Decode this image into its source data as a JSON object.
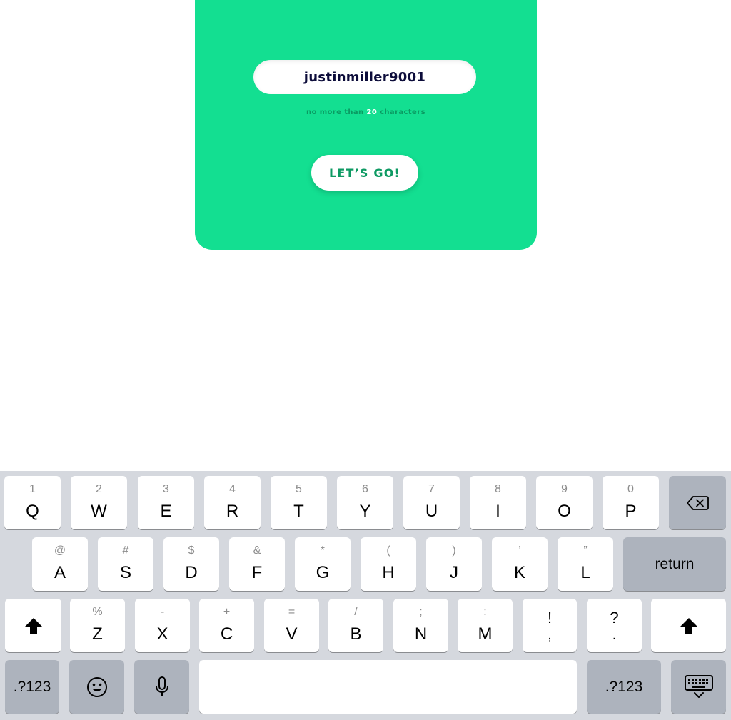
{
  "form": {
    "username_value": "justinmiller9001",
    "hint_prefix": "no more than",
    "hint_number": "20",
    "hint_suffix": "characters",
    "go_label": "LET’S GO!"
  },
  "colors": {
    "card_bg": "#13df91",
    "button_text": "#0e9a63",
    "keyboard_bg": "#d5d8de",
    "key_bg": "#ffffff",
    "key_dark_bg": "#adb3bd"
  },
  "keyboard": {
    "row1": [
      {
        "pri": "Q",
        "sec": "1"
      },
      {
        "pri": "W",
        "sec": "2"
      },
      {
        "pri": "E",
        "sec": "3"
      },
      {
        "pri": "R",
        "sec": "4"
      },
      {
        "pri": "T",
        "sec": "5"
      },
      {
        "pri": "Y",
        "sec": "6"
      },
      {
        "pri": "U",
        "sec": "7"
      },
      {
        "pri": "I",
        "sec": "8"
      },
      {
        "pri": "O",
        "sec": "9"
      },
      {
        "pri": "P",
        "sec": "0"
      }
    ],
    "row2": [
      {
        "pri": "A",
        "sec": "@"
      },
      {
        "pri": "S",
        "sec": "#"
      },
      {
        "pri": "D",
        "sec": "$"
      },
      {
        "pri": "F",
        "sec": "&"
      },
      {
        "pri": "G",
        "sec": "*"
      },
      {
        "pri": "H",
        "sec": "("
      },
      {
        "pri": "J",
        "sec": ")"
      },
      {
        "pri": "K",
        "sec": "’"
      },
      {
        "pri": "L",
        "sec": "”"
      }
    ],
    "row3": [
      {
        "pri": "Z",
        "sec": "%"
      },
      {
        "pri": "X",
        "sec": "-"
      },
      {
        "pri": "C",
        "sec": "+"
      },
      {
        "pri": "V",
        "sec": "="
      },
      {
        "pri": "B",
        "sec": "/"
      },
      {
        "pri": "N",
        "sec": ";"
      },
      {
        "pri": "M",
        "sec": ":"
      }
    ],
    "punct": [
      {
        "top": "!",
        "bot": ","
      },
      {
        "top": "?",
        "bot": "."
      }
    ],
    "return_label": "return",
    "numbers_label": ".?123",
    "icons": [
      "delete-icon",
      "shift-icon",
      "emoji-icon",
      "microphone-icon",
      "keyboard-dismiss-icon"
    ]
  }
}
